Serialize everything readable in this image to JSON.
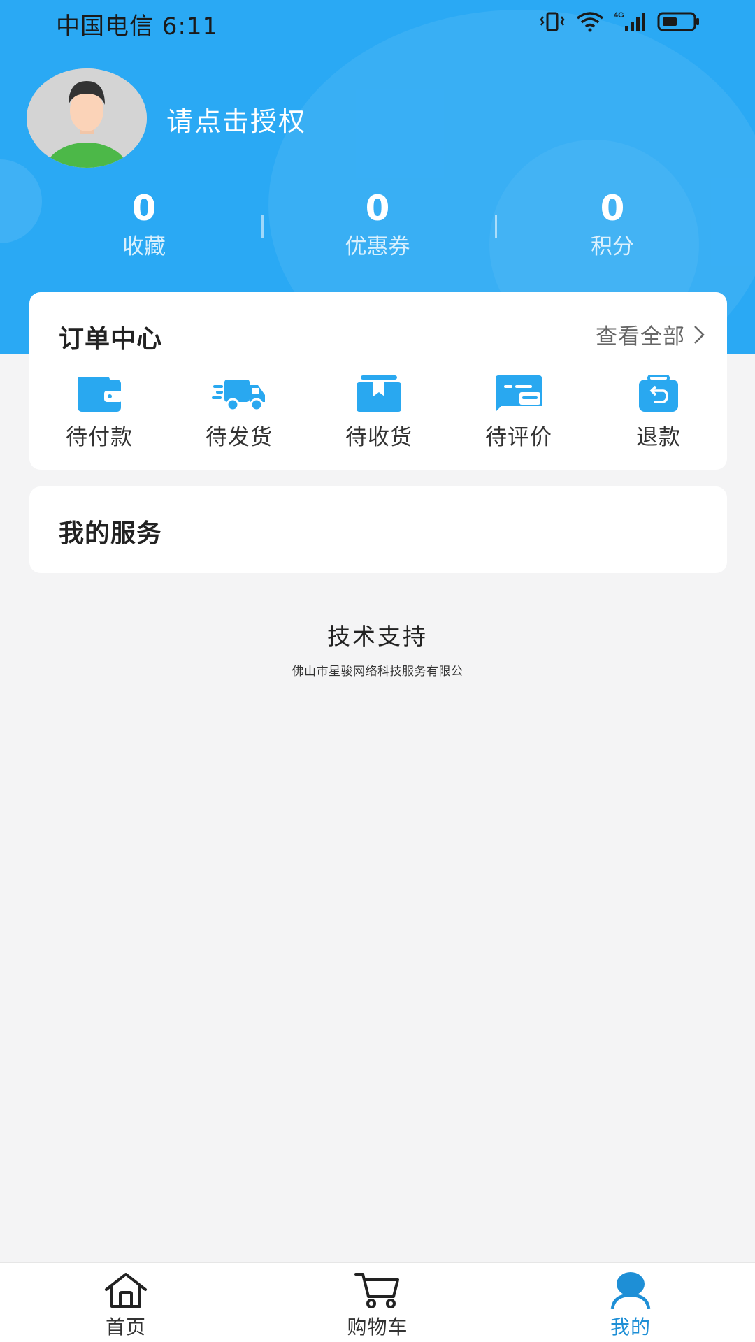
{
  "status_bar": {
    "carrier_time": "中国电信 6:11",
    "network": "4G"
  },
  "user": {
    "name_prompt": "请点击授权"
  },
  "stats": [
    {
      "value": "0",
      "label": "收藏"
    },
    {
      "value": "0",
      "label": "优惠券"
    },
    {
      "value": "0",
      "label": "积分"
    }
  ],
  "order_center": {
    "title": "订单中心",
    "view_all": "查看全部",
    "items": [
      {
        "label": "待付款",
        "icon": "wallet-icon"
      },
      {
        "label": "待发货",
        "icon": "truck-icon"
      },
      {
        "label": "待收货",
        "icon": "package-icon"
      },
      {
        "label": "待评价",
        "icon": "comment-icon"
      },
      {
        "label": "退款",
        "icon": "refund-icon"
      }
    ]
  },
  "services": {
    "title": "我的服务"
  },
  "support": {
    "title": "技术支持",
    "company": "佛山市星骏网络科技服务有限公"
  },
  "tabbar": {
    "tabs": [
      {
        "label": "首页",
        "icon": "home-icon"
      },
      {
        "label": "购物车",
        "icon": "cart-icon"
      },
      {
        "label": "我的",
        "icon": "user-icon"
      }
    ],
    "active": "我的"
  },
  "colors": {
    "header_bg": "#2aa9f4",
    "icon_blue": "#29a8f0",
    "active_tab": "#1e8fd6",
    "page_bg": "#f4f4f5"
  }
}
